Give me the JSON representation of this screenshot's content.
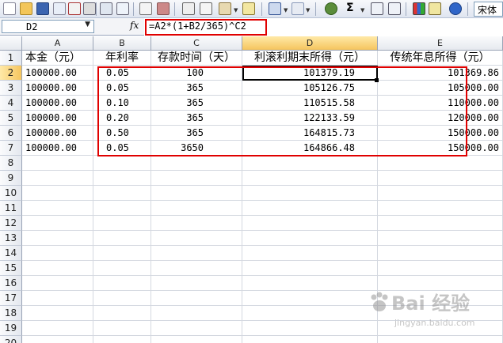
{
  "toolbar": {
    "icons": [
      "new-icon",
      "open-icon",
      "save-icon",
      "permission-icon",
      "email-icon",
      "print-icon",
      "print-preview-icon",
      "spelling-icon",
      "research-icon",
      "cut-icon",
      "copy-icon",
      "paste-icon",
      "format-painter-icon",
      "undo-icon",
      "redo-icon",
      "hyperlink-icon",
      "autosum-icon",
      "sort-ascending-icon",
      "sort-descending-icon",
      "chart-wizard-icon",
      "drawing-icon",
      "help-icon"
    ],
    "font_name": "宋体"
  },
  "formula_bar": {
    "name_box": "D2",
    "fx_label": "fx",
    "formula": "=A2*(1+B2/365)^C2"
  },
  "columns": [
    "A",
    "B",
    "C",
    "D",
    "E"
  ],
  "active_column": "D",
  "rows": [
    "1",
    "2",
    "3",
    "4",
    "5",
    "6",
    "7",
    "8",
    "9",
    "10",
    "11",
    "12",
    "13",
    "14",
    "15",
    "16",
    "17",
    "18",
    "19",
    "20"
  ],
  "active_row": "2",
  "headers": {
    "A": "本金（元）",
    "B": "年利率",
    "C": "存款时间（天）",
    "D": "利滚利期末所得（元）",
    "E": "传统年息所得（元）"
  },
  "table": [
    {
      "A": "100000.00",
      "B": "0.05",
      "C": "100",
      "D": "101379.19",
      "E": "101369.86"
    },
    {
      "A": "100000.00",
      "B": "0.05",
      "C": "365",
      "D": "105126.75",
      "E": "105000.00"
    },
    {
      "A": "100000.00",
      "B": "0.10",
      "C": "365",
      "D": "110515.58",
      "E": "110000.00"
    },
    {
      "A": "100000.00",
      "B": "0.20",
      "C": "365",
      "D": "122133.59",
      "E": "120000.00"
    },
    {
      "A": "100000.00",
      "B": "0.50",
      "C": "365",
      "D": "164815.73",
      "E": "150000.00"
    },
    {
      "A": "100000.00",
      "B": "0.05",
      "C": "3650",
      "D": "164866.48",
      "E": "150000.00"
    }
  ],
  "highlight_color": "#e00000",
  "watermark": {
    "main": "Bai 经验",
    "sub": "jingyan.baidu.com"
  }
}
